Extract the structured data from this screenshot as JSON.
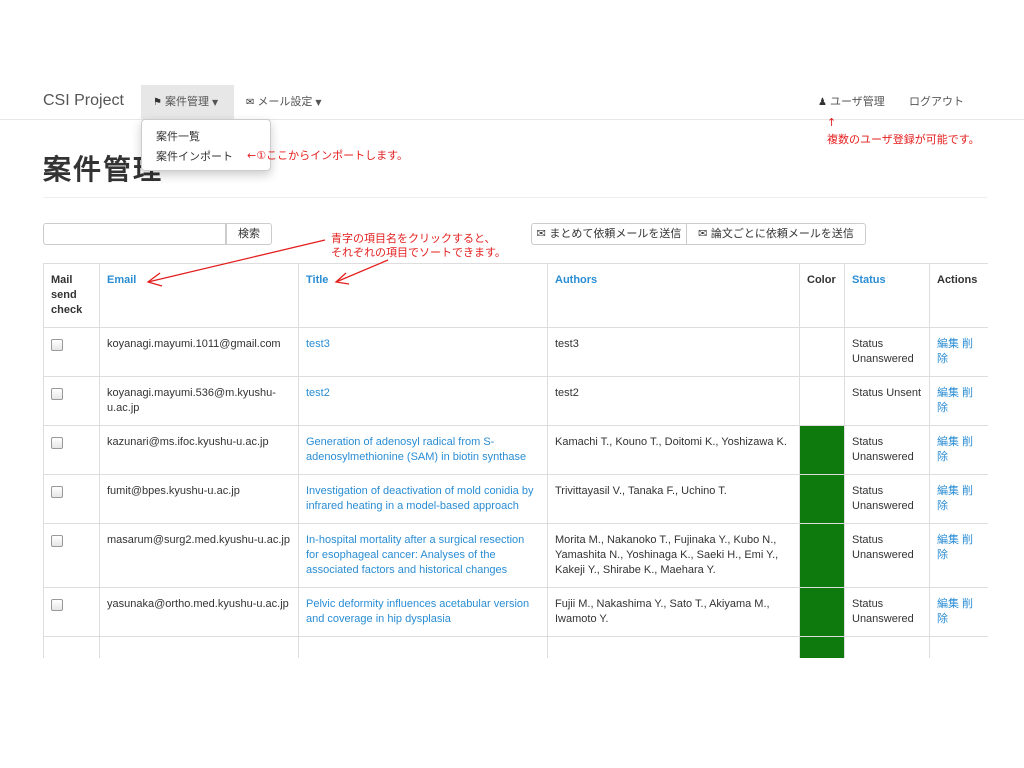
{
  "navbar": {
    "brand": "CSI Project",
    "menu1": {
      "icon": "bookmark-icon",
      "label": "案件管理"
    },
    "menu2": {
      "icon": "envelope-icon",
      "label": "メール設定"
    },
    "user_mgmt": {
      "icon": "user-icon",
      "label": "ユーザ管理"
    },
    "logout": "ログアウト"
  },
  "dropdown": {
    "items": [
      "案件一覧",
      "案件インポート"
    ]
  },
  "annotations": {
    "import_note": "←①ここからインポートします。",
    "user_arrow": "↑",
    "user_note": "複数のユーザ登録が可能です。",
    "sort_note_line1": "青字の項目名をクリックすると、",
    "sort_note_line2": "それぞれの項目でソートできます。",
    "color": "#e41e1e"
  },
  "page": {
    "title": "案件管理"
  },
  "search": {
    "placeholder": "",
    "button": "検索"
  },
  "mail_buttons": {
    "bulk": {
      "icon": "envelope-icon",
      "label": "まとめて依頼メールを送信"
    },
    "per_paper": {
      "icon": "envelope-icon",
      "label": "論文ごとに依頼メールを送信"
    }
  },
  "table": {
    "headers": {
      "mail": "Mail send check",
      "email": "Email",
      "title": "Title",
      "authors": "Authors",
      "color": "Color",
      "status": "Status",
      "actions": "Actions"
    },
    "rows": [
      {
        "email": "koyanagi.mayumi.1011@gmail.com",
        "title": "test3",
        "authors": "test3",
        "color": "",
        "status": "Status Unanswered",
        "actions": "編集 削除"
      },
      {
        "email": "koyanagi.mayumi.536@m.kyushu-u.ac.jp",
        "title": "test2",
        "authors": "test2",
        "color": "",
        "status": "Status Unsent",
        "actions": "編集 削除"
      },
      {
        "email": "kazunari@ms.ifoc.kyushu-u.ac.jp",
        "title": "Generation of adenosyl radical from S-adenosylmethionine (SAM) in biotin synthase",
        "authors": "Kamachi T., Kouno T., Doitomi K., Yoshizawa K.",
        "color": "#0e7a0e",
        "status": "Status Unanswered",
        "actions": "編集 削除"
      },
      {
        "email": "fumit@bpes.kyushu-u.ac.jp",
        "title": "Investigation of deactivation of mold conidia by infrared heating in a model-based approach",
        "authors": "Trivittayasil V., Tanaka F., Uchino T.",
        "color": "#0e7a0e",
        "status": "Status Unanswered",
        "actions": "編集 削除"
      },
      {
        "email": "masarum@surg2.med.kyushu-u.ac.jp",
        "title": "In-hospital mortality after a surgical resection for esophageal cancer: Analyses of the associated factors and historical changes",
        "authors": "Morita M., Nakanoko T., Fujinaka Y., Kubo N., Yamashita N., Yoshinaga K., Saeki H., Emi Y., Kakeji Y., Shirabe K., Maehara Y.",
        "color": "#0e7a0e",
        "status": "Status Unanswered",
        "actions": "編集 削除"
      },
      {
        "email": "yasunaka@ortho.med.kyushu-u.ac.jp",
        "title": "Pelvic deformity influences acetabular version and coverage in hip dysplasia",
        "authors": "Fujii M., Nakashima Y., Sato T., Akiyama M., Iwamoto Y.",
        "color": "#0e7a0e",
        "status": "Status Unanswered",
        "actions": "編集 削除"
      },
      {
        "email": "",
        "title": "",
        "authors": "",
        "color": "#0e7a0e",
        "status": "",
        "actions": ""
      }
    ]
  }
}
